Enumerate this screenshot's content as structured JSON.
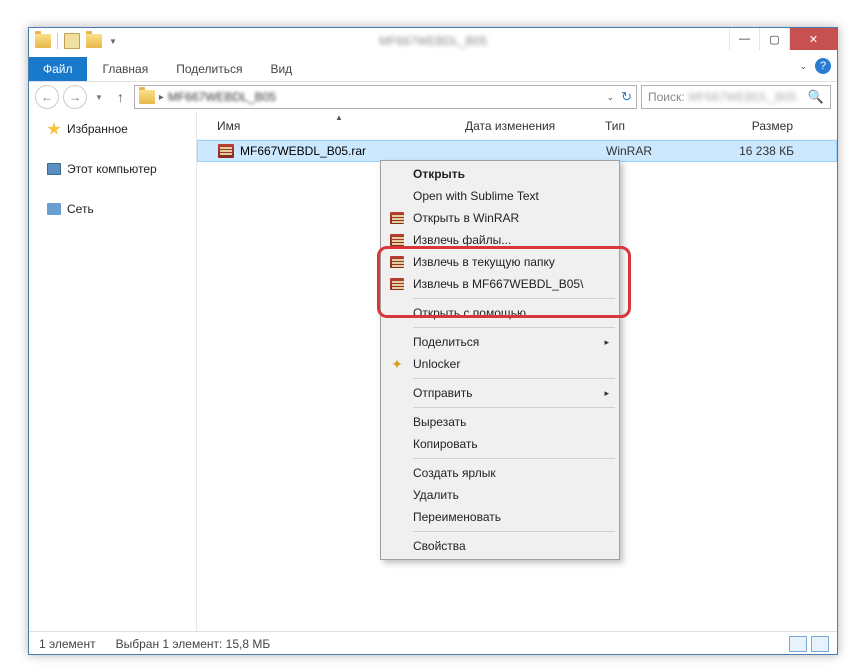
{
  "window": {
    "title": "MF667WEBDL_B05"
  },
  "ribbon": {
    "file_tab": "Файл",
    "tabs": [
      "Главная",
      "Поделиться",
      "Вид"
    ]
  },
  "address": {
    "crumb": "MF667WEBDL_B05"
  },
  "search": {
    "label": "Поиск:",
    "placeholder": "MF667WEBDL_B05"
  },
  "sidebar": {
    "favorites": "Избранное",
    "this_pc": "Этот компьютер",
    "network": "Сеть"
  },
  "columns": {
    "name": "Имя",
    "date": "Дата изменения",
    "type": "Тип",
    "size": "Размер"
  },
  "file": {
    "name": "MF667WEBDL_B05.rar",
    "date": "",
    "type": "WinRAR",
    "size": "16 238 КБ"
  },
  "context_menu": {
    "open": "Открыть",
    "sublime": "Open with Sublime Text",
    "open_winrar": "Открыть в WinRAR",
    "extract_files": "Извлечь файлы...",
    "extract_here": "Извлечь в текущую папку",
    "extract_to": "Извлечь в MF667WEBDL_B05\\",
    "open_with": "Открыть с помощью...",
    "share": "Поделиться",
    "unlocker": "Unlocker",
    "send_to": "Отправить",
    "cut": "Вырезать",
    "copy": "Копировать",
    "shortcut": "Создать ярлык",
    "delete": "Удалить",
    "rename": "Переименовать",
    "properties": "Свойства"
  },
  "status": {
    "count": "1 элемент",
    "selected": "Выбран 1 элемент: 15,8 МБ"
  }
}
